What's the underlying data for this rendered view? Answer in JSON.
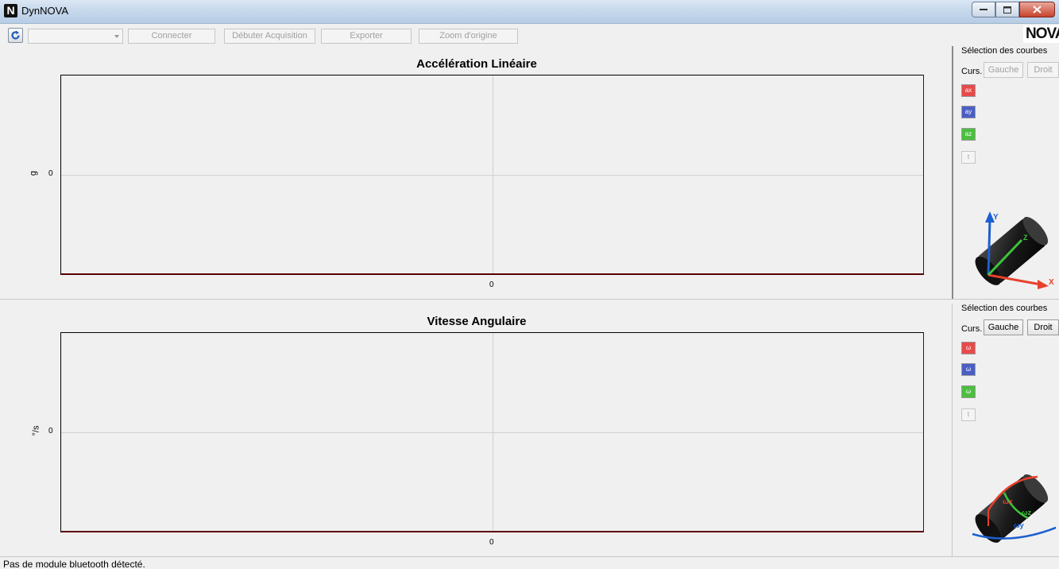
{
  "window": {
    "title": "DynNOVA",
    "icon_letter": "N"
  },
  "toolbar": {
    "port_value": "",
    "connect_label": "Connecter",
    "start_label": "Débuter Acquisition",
    "export_label": "Exporter",
    "zoom_label": "Zoom d'origine"
  },
  "logo": {
    "text": "NOVA"
  },
  "chart_data": [
    {
      "type": "line",
      "title": "Accélération Linéaire",
      "ylabel": "g",
      "xlabel": "",
      "x_ticks": [
        "0"
      ],
      "y_ticks": [
        "0"
      ],
      "series": [],
      "grid": true
    },
    {
      "type": "line",
      "title": "Vitesse Angulaire",
      "ylabel": "°/s",
      "xlabel": "",
      "x_ticks": [
        "0"
      ],
      "y_ticks": [
        "0"
      ],
      "series": [],
      "grid": true
    }
  ],
  "side1": {
    "title": "Sélection des courbes",
    "curs_label": "Curs.",
    "left_label": "Gauche",
    "right_label": "Droit",
    "curves": [
      {
        "label": "ax",
        "color": "#e84a4a"
      },
      {
        "label": "ay",
        "color": "#4a5fc4"
      },
      {
        "label": "az",
        "color": "#4bbf3f"
      },
      {
        "label": "t",
        "color": "#f4f4f4"
      }
    ],
    "axis_y": "Y",
    "axis_x": "X",
    "axis_z": "Z"
  },
  "side2": {
    "title": "Sélection des courbes",
    "curs_label": "Curs.",
    "left_label": "Gauche",
    "right_label": "Droit",
    "curves": [
      {
        "label": "ω",
        "color": "#e84a4a"
      },
      {
        "label": "ω",
        "color": "#4a5fc4"
      },
      {
        "label": "ω",
        "color": "#4bbf3f"
      },
      {
        "label": "t",
        "color": "#f4f4f4"
      }
    ],
    "omega_x": "ωx",
    "omega_y": "ωy",
    "omega_z": "ωz"
  },
  "status": {
    "text": "Pas de module bluetooth détecté."
  }
}
